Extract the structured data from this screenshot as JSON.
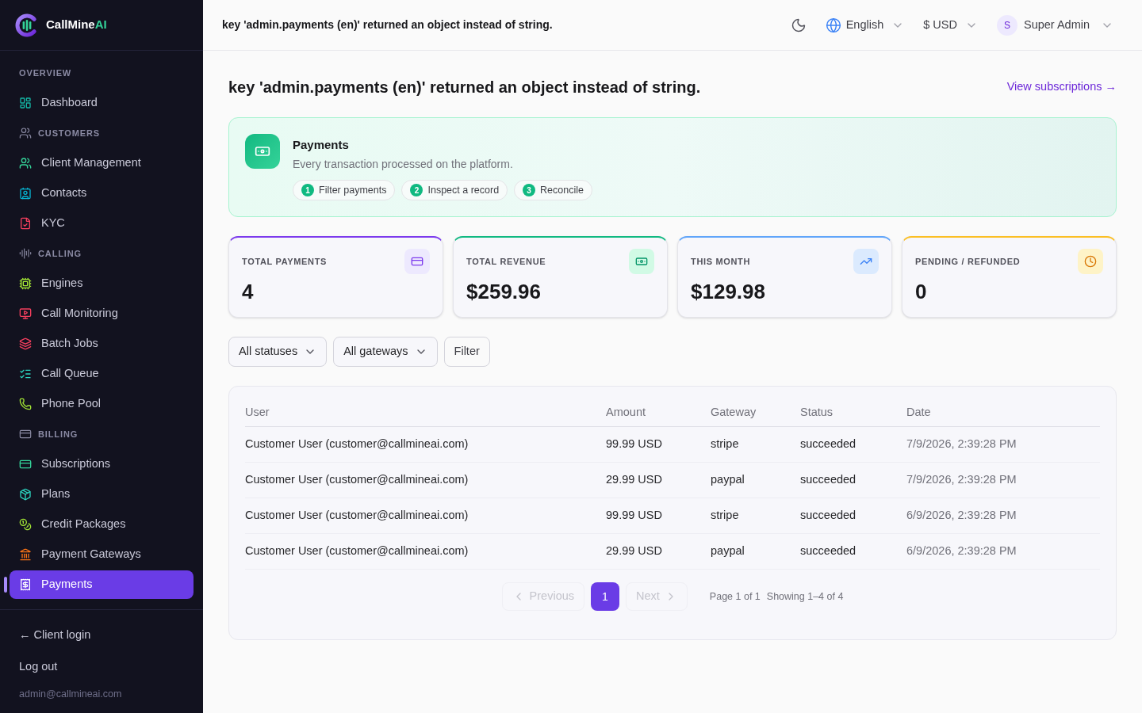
{
  "sidebar": {
    "brand": {
      "name": "CallMine",
      "accent": "AI"
    },
    "sections": [
      {
        "title": "OVERVIEW",
        "items": [
          {
            "label": "Dashboard",
            "selected": false
          }
        ]
      },
      {
        "title": "CUSTOMERS",
        "items": [
          {
            "label": "Client Management",
            "selected": false
          },
          {
            "label": "Contacts",
            "selected": false
          },
          {
            "label": "KYC",
            "selected": false
          }
        ]
      },
      {
        "title": "CALLING",
        "items": [
          {
            "label": "Engines",
            "selected": false
          },
          {
            "label": "Call Monitoring",
            "selected": false
          },
          {
            "label": "Batch Jobs",
            "selected": false
          },
          {
            "label": "Call Queue",
            "selected": false
          },
          {
            "label": "Phone Pool",
            "selected": false
          }
        ]
      },
      {
        "title": "BILLING",
        "items": [
          {
            "label": "Subscriptions",
            "selected": false
          },
          {
            "label": "Plans",
            "selected": false
          },
          {
            "label": "Credit Packages",
            "selected": false
          },
          {
            "label": "Payment Gateways",
            "selected": false
          },
          {
            "label": "Payments",
            "selected": true
          }
        ]
      }
    ],
    "footer_links": [
      "← Client login",
      "Log out"
    ],
    "user_email": "admin@callmineai.com"
  },
  "topbar": {
    "title": "key 'admin.payments (en)' returned an object instead of string.",
    "language": "English",
    "currency": "$ USD",
    "user": {
      "initial": "S",
      "name": "Super Admin"
    }
  },
  "page": {
    "heading": "key 'admin.payments (en)' returned an object instead of string.",
    "link": "View subscriptions →"
  },
  "banner": {
    "title": "Payments",
    "description": "Every transaction processed on the platform.",
    "steps": [
      {
        "number": "1",
        "label": "Filter payments"
      },
      {
        "number": "2",
        "label": "Inspect a record"
      },
      {
        "number": "3",
        "label": "Reconcile"
      }
    ]
  },
  "stats": [
    {
      "label": "TOTAL PAYMENTS",
      "value": "4"
    },
    {
      "label": "TOTAL REVENUE",
      "value": "$259.96"
    },
    {
      "label": "THIS MONTH",
      "value": "$129.98"
    },
    {
      "label": "PENDING / REFUNDED",
      "value": "0"
    }
  ],
  "filters": [
    {
      "kind": "select",
      "label": "All statuses"
    },
    {
      "kind": "select",
      "label": "All gateways"
    },
    {
      "kind": "button",
      "label": "Filter"
    }
  ],
  "table": {
    "columns": [
      "User",
      "Amount",
      "Gateway",
      "Status",
      "Date"
    ],
    "rows": [
      [
        "Customer User (customer@callmineai.com)",
        "99.99 USD",
        "stripe",
        "succeeded",
        "7/9/2026, 2:39:28 PM"
      ],
      [
        "Customer User (customer@callmineai.com)",
        "29.99 USD",
        "paypal",
        "succeeded",
        "7/9/2026, 2:39:28 PM"
      ],
      [
        "Customer User (customer@callmineai.com)",
        "99.99 USD",
        "stripe",
        "succeeded",
        "6/9/2026, 2:39:28 PM"
      ],
      [
        "Customer User (customer@callmineai.com)",
        "29.99 USD",
        "paypal",
        "succeeded",
        "6/9/2026, 2:39:28 PM"
      ]
    ]
  },
  "pagination": {
    "previous": {
      "label": "Previous",
      "disabled": true
    },
    "pages": [
      {
        "label": "1",
        "selected": true
      }
    ],
    "next": {
      "label": "Next",
      "disabled": true
    },
    "page_info": "Page 1 of 1",
    "showing": "Showing 1–4 of 4"
  }
}
